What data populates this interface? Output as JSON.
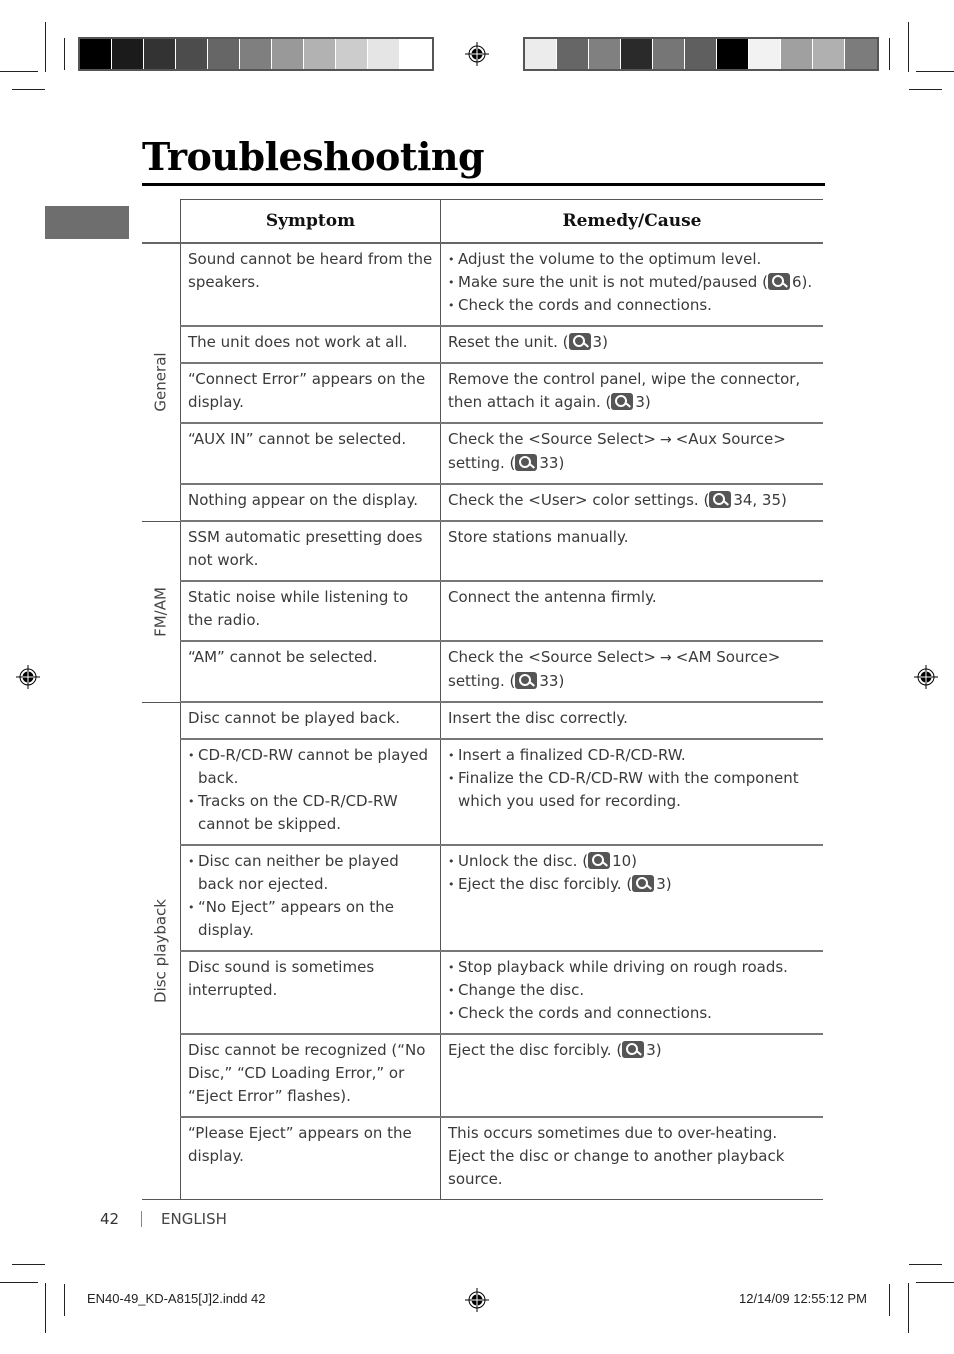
{
  "page": {
    "title": "Troubleshooting",
    "page_number": "42",
    "language": "ENGLISH",
    "slug_left": "EN40-49_KD-A815[J]2.indd   42",
    "slug_right": "12/14/09   12:55:12 PM"
  },
  "colors": {
    "left_bar": [
      "#000000",
      "#1b1b1b",
      "#333333",
      "#4c4c4c",
      "#666666",
      "#7f7f7f",
      "#999999",
      "#b2b2b2",
      "#cccccc",
      "#e5e5e5",
      "#ffffff"
    ],
    "right_bar": [
      "#ececec",
      "#666666",
      "#808080",
      "#2a2a2a",
      "#767676",
      "#5f5f5f",
      "#000000",
      "#f2f2f2",
      "#a0a0a0",
      "#b0b0b0",
      "#7c7c7c"
    ],
    "side_tab": "#6e6e6e"
  },
  "table": {
    "headers": {
      "symptom": "Symptom",
      "remedy": "Remedy/Cause"
    },
    "ref_icon": "magnifier-reference-icon",
    "arrow": "→",
    "categories": [
      {
        "label": "General",
        "rows": [
          {
            "symptom": [
              "Sound cannot be heard from the speakers."
            ],
            "remedy": [
              {
                "text": "Adjust the volume to the optimum level."
              },
              {
                "text": "Make sure the unit is not muted/paused (",
                "ref": "6",
                "after": ")."
              },
              {
                "text": "Check the cords and connections."
              }
            ],
            "remedy_bulleted": true
          },
          {
            "symptom": [
              "The unit does not work at all."
            ],
            "remedy": [
              {
                "text": "Reset the unit. (",
                "ref": "3",
                "after": ")"
              }
            ]
          },
          {
            "symptom": [
              "“Connect Error” appears on the display."
            ],
            "remedy": [
              {
                "text": "Remove the control panel, wipe the connector, then attach it again. (",
                "ref": "3",
                "after": ")"
              }
            ]
          },
          {
            "symptom": [
              "“AUX IN” cannot be selected."
            ],
            "remedy": [
              {
                "text": "Check the <Source Select>",
                "arrow_after": "<Aux Source> setting. (",
                "ref": "33",
                "after": ")"
              }
            ]
          },
          {
            "symptom": [
              "Nothing appear on the display."
            ],
            "remedy": [
              {
                "text": "Check the <User> color settings. (",
                "ref": "34, 35",
                "after": ")"
              }
            ]
          }
        ]
      },
      {
        "label": "FM/AM",
        "rows": [
          {
            "symptom": [
              "SSM automatic presetting does not work."
            ],
            "remedy": [
              {
                "text": "Store stations manually."
              }
            ]
          },
          {
            "symptom": [
              "Static noise while listening to the radio."
            ],
            "remedy": [
              {
                "text": "Connect the antenna firmly."
              }
            ]
          },
          {
            "symptom": [
              "“AM” cannot be selected."
            ],
            "remedy": [
              {
                "text": "Check the <Source Select>",
                "arrow_after": "<AM Source> setting. (",
                "ref": "33",
                "after": ")"
              }
            ]
          }
        ]
      },
      {
        "label": "Disc playback",
        "rows": [
          {
            "symptom": [
              "Disc cannot be played back."
            ],
            "remedy": [
              {
                "text": "Insert the disc correctly."
              }
            ]
          },
          {
            "symptom": [
              "CD-R/CD-RW cannot be played back.",
              "Tracks on the CD-R/CD-RW cannot be skipped."
            ],
            "symptom_bulleted": true,
            "remedy": [
              {
                "text": "Insert a finalized CD-R/CD-RW."
              },
              {
                "text": "Finalize the CD-R/CD-RW with the component which you used for recording."
              }
            ],
            "remedy_bulleted": true
          },
          {
            "symptom": [
              "Disc can neither be played back nor ejected.",
              "“No Eject” appears on the display."
            ],
            "symptom_bulleted": true,
            "remedy": [
              {
                "text": "Unlock the disc. (",
                "ref": "10",
                "after": ")"
              },
              {
                "text": "Eject the disc forcibly. (",
                "ref": "3",
                "after": ")"
              }
            ],
            "remedy_bulleted": true
          },
          {
            "symptom": [
              "Disc sound is sometimes interrupted."
            ],
            "remedy": [
              {
                "text": "Stop playback while driving on rough roads."
              },
              {
                "text": "Change the disc."
              },
              {
                "text": "Check the cords and connections."
              }
            ],
            "remedy_bulleted": true
          },
          {
            "symptom": [
              "Disc cannot be recognized (“No Disc,” “CD Loading Error,” or “Eject Error” flashes)."
            ],
            "remedy": [
              {
                "text": "Eject the disc forcibly. (",
                "ref": "3",
                "after": ")"
              }
            ]
          },
          {
            "symptom": [
              "“Please Eject” appears on the display."
            ],
            "remedy": [
              {
                "text": "This occurs sometimes due to over-heating. Eject the disc or change to another playback source."
              }
            ]
          }
        ]
      }
    ]
  }
}
